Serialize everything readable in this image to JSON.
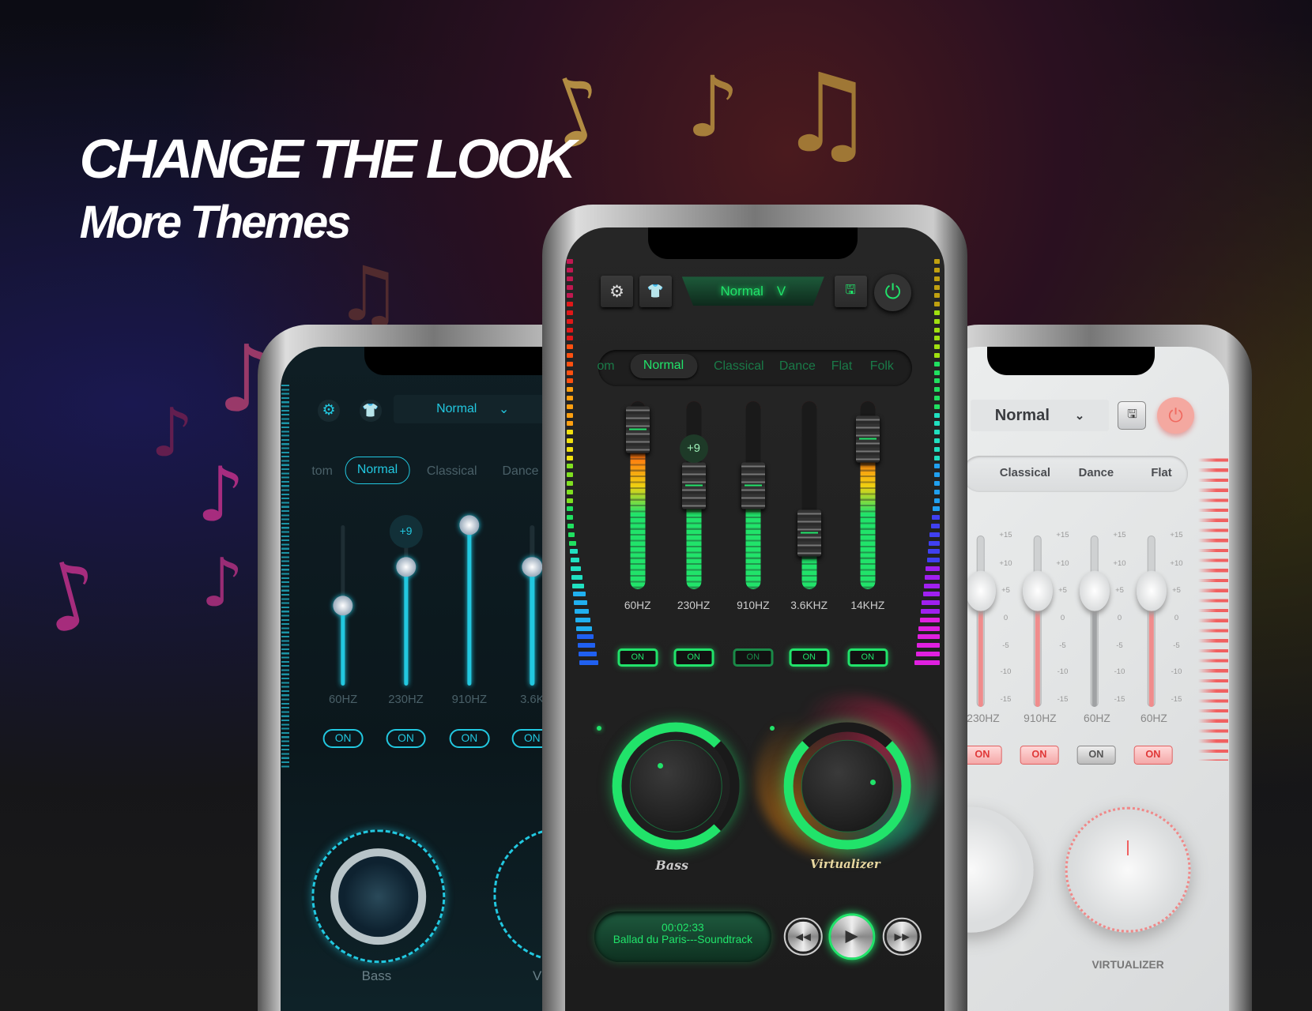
{
  "headline": {
    "line1": "CHANGE THE LOOK",
    "line2": "More Themes"
  },
  "decor": {
    "note_colors": [
      "#c9a24a",
      "#c0308a",
      "#b04070",
      "#a06a40"
    ]
  },
  "left_phone": {
    "theme": "dark-teal",
    "accent": "#22c8e0",
    "preset": "Normal",
    "tabs": [
      "tom",
      "Normal",
      "Classical",
      "Dance"
    ],
    "active_tab": 1,
    "bands": [
      {
        "label": "60HZ",
        "level": 0.5,
        "on": "ON"
      },
      {
        "label": "230HZ",
        "level": 0.74,
        "on": "ON",
        "bubble": "+9"
      },
      {
        "label": "910HZ",
        "level": 1.0,
        "on": "ON"
      },
      {
        "label": "3.6K",
        "level": 0.74,
        "on": "ON"
      }
    ],
    "knob_labels": [
      "Bass",
      "V"
    ]
  },
  "center_phone": {
    "theme": "dark-neon-green",
    "accent": "#21e36a",
    "preset": "Normal",
    "preset_chevron": "V",
    "tabs": [
      "om",
      "Normal",
      "Classical",
      "Dance",
      "Flat",
      "Folk"
    ],
    "active_tab": 1,
    "bands": [
      {
        "label": "60HZ",
        "level": 0.85,
        "on": "ON"
      },
      {
        "label": "230HZ",
        "level": 0.55,
        "on": "ON",
        "bubble": "+9"
      },
      {
        "label": "910HZ",
        "level": 0.55,
        "on": "ON"
      },
      {
        "label": "3.6KHZ",
        "level": 0.3,
        "on": "ON"
      },
      {
        "label": "14KHZ",
        "level": 0.8,
        "on": "ON"
      }
    ],
    "bass_label": "Bass",
    "virtualizer_label": "Virtualizer",
    "bass_level": 0.6,
    "virtualizer_level": 0.7,
    "player": {
      "time": "00:02:33",
      "track": "Ballad du Paris---Soundtrack"
    }
  },
  "right_phone": {
    "theme": "light-pink",
    "accent": "#f07070",
    "preset": "Normal",
    "tabs": [
      "Classical",
      "Dance",
      "Flat"
    ],
    "scale": [
      "+15",
      "+10",
      "+5",
      "0",
      "-5",
      "-10",
      "-15"
    ],
    "bands": [
      {
        "label": "230HZ",
        "level": 0.7,
        "on": "ON"
      },
      {
        "label": "910HZ",
        "level": 0.7,
        "on": "ON"
      },
      {
        "label": "60HZ",
        "level": 0.7,
        "on": "ON",
        "off_style": true
      },
      {
        "label": "60HZ",
        "level": 0.7,
        "on": "ON"
      }
    ],
    "knob_label": "VIRTUALIZER"
  }
}
